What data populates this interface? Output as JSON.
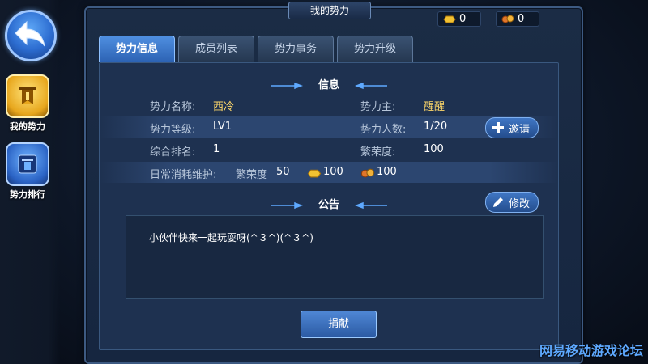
{
  "window": {
    "title": "我的势力"
  },
  "currency": [
    {
      "icon": "gold-ingot-icon",
      "value": "0"
    },
    {
      "icon": "coin-bag-icon",
      "value": "0"
    }
  ],
  "sidebar": {
    "back_icon": "back-arrow-icon",
    "items": [
      {
        "label": "我的势力",
        "icon": "force-banner-icon",
        "active": true
      },
      {
        "label": "势力排行",
        "icon": "ranking-icon",
        "active": false
      }
    ]
  },
  "tabs": [
    {
      "label": "势力信息",
      "active": true
    },
    {
      "label": "成员列表",
      "active": false
    },
    {
      "label": "势力事务",
      "active": false
    },
    {
      "label": "势力升级",
      "active": false
    }
  ],
  "info": {
    "section_title": "信息",
    "name_label": "势力名称:",
    "name_value": "西冷",
    "leader_label": "势力主:",
    "leader_value": "醒醒",
    "level_label": "势力等级:",
    "level_value": "LV1",
    "members_label": "势力人数:",
    "members_value": "1/20",
    "invite_label": "邀请",
    "rank_label": "综合排名:",
    "rank_value": "1",
    "prosperity_label": "繁荣度:",
    "prosperity_value": "100",
    "upkeep_label": "日常消耗维护:",
    "upkeep_prosperity_label": "繁荣度",
    "upkeep_prosperity_value": "50",
    "upkeep_gold_value": "100",
    "upkeep_coin_value": "100"
  },
  "notice": {
    "section_title": "公告",
    "edit_label": "修改",
    "text": "小伙伴快来一起玩耍呀(^３^)(^３^)"
  },
  "donate_label": "捐献",
  "footer": {
    "forum": "网易移动游戏论坛"
  },
  "colors": {
    "accent": "#4f8fe0",
    "gold": "#ffd86a",
    "panel": "#1e3150"
  }
}
